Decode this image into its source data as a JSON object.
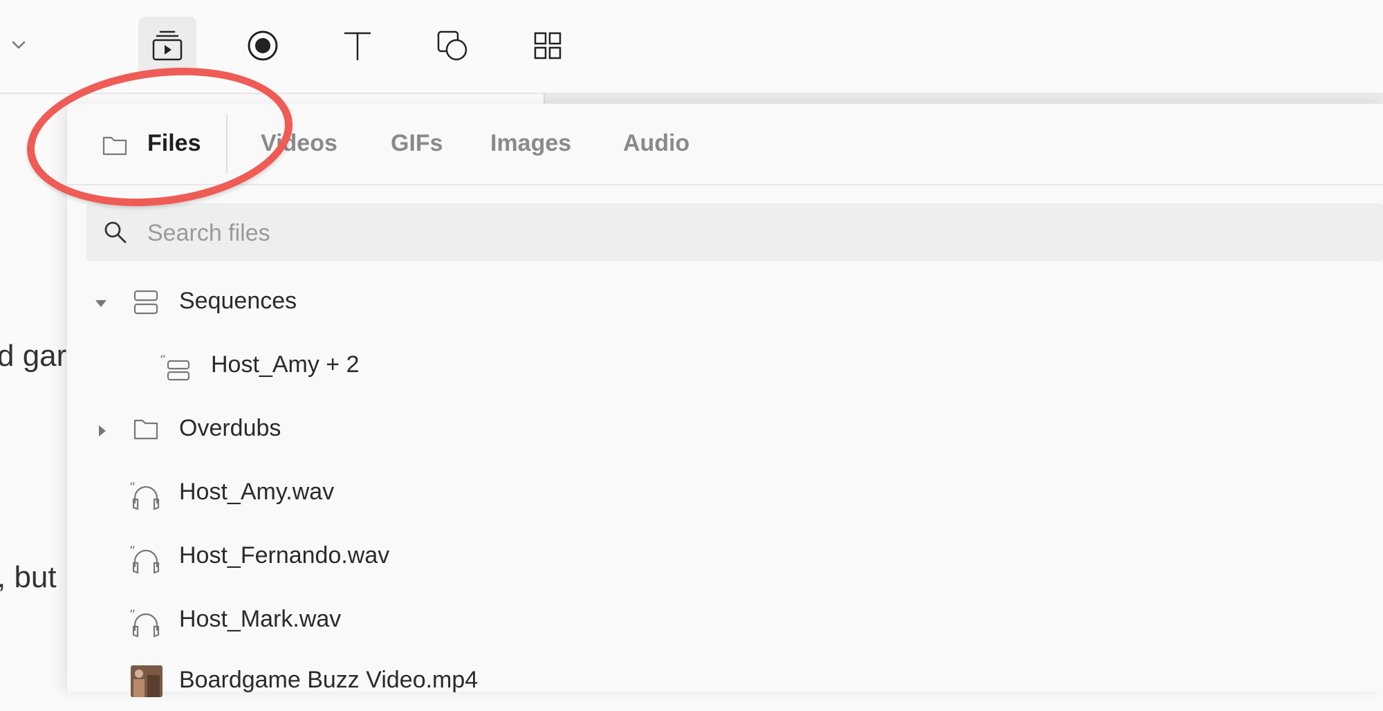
{
  "tabs": {
    "files": "Files",
    "videos": "Videos",
    "gifs": "GIFs",
    "images": "Images",
    "audio": "Audio"
  },
  "search": {
    "placeholder": "Search files"
  },
  "tree": {
    "sequences": "Sequences",
    "sequence_item": "Host_Amy + 2",
    "overdubs": "Overdubs",
    "files": [
      "Host_Amy.wav",
      "Host_Fernando.wav",
      "Host_Mark.wav",
      "Boardgame Buzz Video.mp4"
    ]
  },
  "background_text": {
    "line1": "d gar",
    "line2": ", but"
  },
  "colors": {
    "annotation": "#ef5b55",
    "active_tab_bg": "#ececec"
  }
}
